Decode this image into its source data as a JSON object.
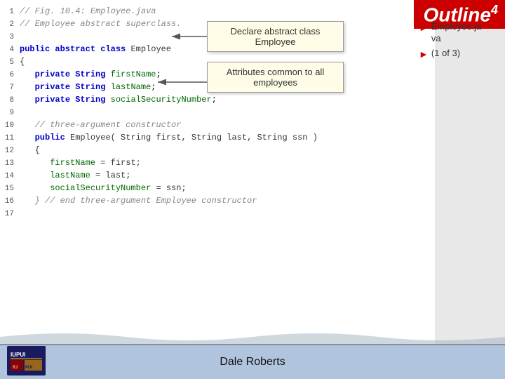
{
  "outline": {
    "label": "Outline",
    "number": "4"
  },
  "tooltip_declare": {
    "line1": "Declare abstract class",
    "line2": "Employee"
  },
  "tooltip_attrs": {
    "line1": "Attributes common to all",
    "line2": "employees"
  },
  "right_panel": {
    "items": [
      {
        "text": "Employee.java"
      },
      {
        "text": "(1 of 3)"
      }
    ]
  },
  "code": {
    "lines": [
      {
        "num": "1",
        "text": "// Fig. 10.4: Employee.java",
        "type": "comment"
      },
      {
        "num": "2",
        "text": "// Employee abstract superclass.",
        "type": "comment"
      },
      {
        "num": "3",
        "text": "",
        "type": "normal"
      },
      {
        "num": "4",
        "text": "public abstract class Employee",
        "type": "keyword-line"
      },
      {
        "num": "5",
        "text": "{",
        "type": "normal"
      },
      {
        "num": "6",
        "text": "   private String firstName;",
        "type": "field-line"
      },
      {
        "num": "7",
        "text": "   private String lastName;",
        "type": "field-line"
      },
      {
        "num": "8",
        "text": "   private String socialSecurityNumber;",
        "type": "field-line"
      },
      {
        "num": "9",
        "text": "",
        "type": "normal"
      },
      {
        "num": "10",
        "text": "   // three-argument constructor",
        "type": "comment"
      },
      {
        "num": "11",
        "text": "   public Employee( String first, String last, String ssn )",
        "type": "method"
      },
      {
        "num": "12",
        "text": "   {",
        "type": "normal"
      },
      {
        "num": "13",
        "text": "      firstName = first;",
        "type": "normal"
      },
      {
        "num": "14",
        "text": "      lastName = last;",
        "type": "normal"
      },
      {
        "num": "15",
        "text": "      socialSecurityNumber = ssn;",
        "type": "normal"
      },
      {
        "num": "16",
        "text": "   } // end three-argument Employee constructor",
        "type": "comment-end"
      },
      {
        "num": "17",
        "text": "",
        "type": "normal"
      }
    ]
  },
  "footer": {
    "name": "Dale Roberts"
  },
  "iupui_logo_alt": "IUPUI Logo"
}
